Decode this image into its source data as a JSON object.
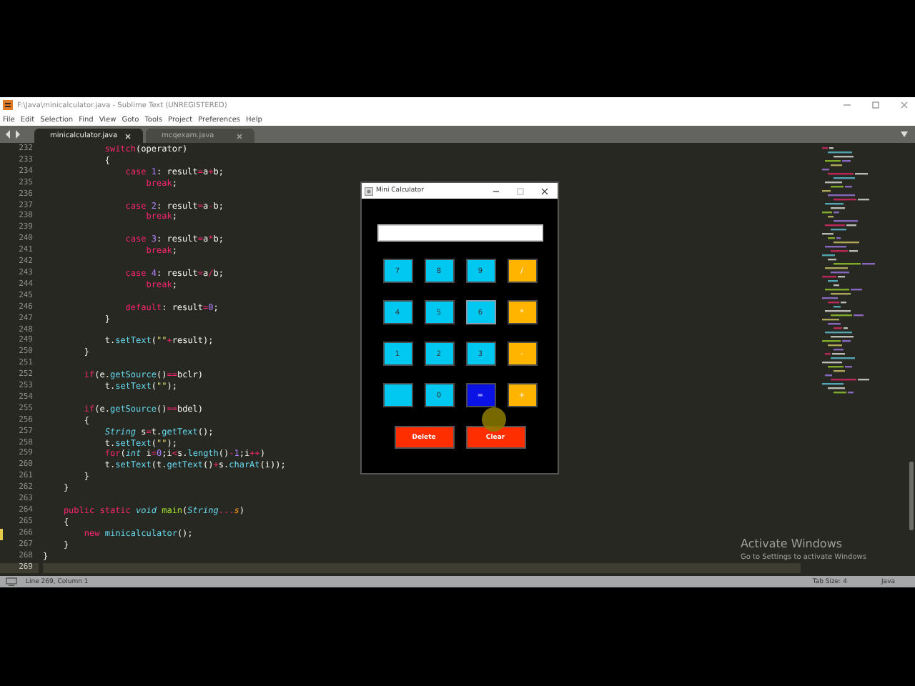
{
  "window": {
    "title": "F:\\Java\\minicalculator.java - Sublime Text (UNREGISTERED)"
  },
  "menu": [
    "File",
    "Edit",
    "Selection",
    "Find",
    "View",
    "Goto",
    "Tools",
    "Project",
    "Preferences",
    "Help"
  ],
  "tabs": [
    {
      "label": "minicalculator.java",
      "selected": true
    },
    {
      "label": "mcqexam.java",
      "selected": false
    }
  ],
  "editor": {
    "lines": [
      {
        "number": "232",
        "current": false,
        "modified": false,
        "tokens": [
          {
            "text": "            switch",
            "kind": "keyword"
          },
          {
            "text": "(operator)",
            "kind": "plain"
          }
        ]
      },
      {
        "number": "233",
        "current": false,
        "modified": false,
        "tokens": [
          {
            "text": "            {",
            "kind": "plain"
          }
        ]
      },
      {
        "number": "234",
        "current": false,
        "modified": false,
        "tokens": [
          {
            "text": "                case",
            "kind": "keyword"
          },
          {
            "text": " 1",
            "kind": "number"
          },
          {
            "text": ": result",
            "kind": "plain"
          },
          {
            "text": "=",
            "kind": "keyword"
          },
          {
            "text": "a",
            "kind": "plain"
          },
          {
            "text": "+",
            "kind": "keyword"
          },
          {
            "text": "b;",
            "kind": "plain"
          }
        ]
      },
      {
        "number": "235",
        "current": false,
        "modified": false,
        "tokens": [
          {
            "text": "                    break",
            "kind": "keyword"
          },
          {
            "text": ";",
            "kind": "plain"
          }
        ]
      },
      {
        "number": "236",
        "current": false,
        "modified": false
      },
      {
        "number": "237",
        "current": false,
        "modified": false,
        "tokens": [
          {
            "text": "                case",
            "kind": "keyword"
          },
          {
            "text": " 2",
            "kind": "number"
          },
          {
            "text": ": result",
            "kind": "plain"
          },
          {
            "text": "=",
            "kind": "keyword"
          },
          {
            "text": "a",
            "kind": "plain"
          },
          {
            "text": "-",
            "kind": "keyword"
          },
          {
            "text": "b;",
            "kind": "plain"
          }
        ]
      },
      {
        "number": "238",
        "current": false,
        "modified": false,
        "tokens": [
          {
            "text": "                    break",
            "kind": "keyword"
          },
          {
            "text": ";",
            "kind": "plain"
          }
        ]
      },
      {
        "number": "239",
        "current": false,
        "modified": false
      },
      {
        "number": "240",
        "current": false,
        "modified": false,
        "tokens": [
          {
            "text": "                case",
            "kind": "keyword"
          },
          {
            "text": " 3",
            "kind": "number"
          },
          {
            "text": ": result",
            "kind": "plain"
          },
          {
            "text": "=",
            "kind": "keyword"
          },
          {
            "text": "a",
            "kind": "plain"
          },
          {
            "text": "*",
            "kind": "keyword"
          },
          {
            "text": "b;",
            "kind": "plain"
          }
        ]
      },
      {
        "number": "241",
        "current": false,
        "modified": false,
        "tokens": [
          {
            "text": "                    break",
            "kind": "keyword"
          },
          {
            "text": ";",
            "kind": "plain"
          }
        ]
      },
      {
        "number": "242",
        "current": false,
        "modified": false
      },
      {
        "number": "243",
        "current": false,
        "modified": false,
        "tokens": [
          {
            "text": "                case",
            "kind": "keyword"
          },
          {
            "text": " 4",
            "kind": "number"
          },
          {
            "text": ": result",
            "kind": "plain"
          },
          {
            "text": "=",
            "kind": "keyword"
          },
          {
            "text": "a",
            "kind": "plain"
          },
          {
            "text": "/",
            "kind": "keyword"
          },
          {
            "text": "b;",
            "kind": "plain"
          }
        ]
      },
      {
        "number": "244",
        "current": false,
        "modified": false,
        "tokens": [
          {
            "text": "                    break",
            "kind": "keyword"
          },
          {
            "text": ";",
            "kind": "plain"
          }
        ]
      },
      {
        "number": "245",
        "current": false,
        "modified": false
      },
      {
        "number": "246",
        "current": false,
        "modified": false,
        "tokens": [
          {
            "text": "                default",
            "kind": "keyword"
          },
          {
            "text": ": result",
            "kind": "plain"
          },
          {
            "text": "=",
            "kind": "keyword"
          },
          {
            "text": "0",
            "kind": "number"
          },
          {
            "text": ";",
            "kind": "plain"
          }
        ]
      },
      {
        "number": "247",
        "current": false,
        "modified": false,
        "tokens": [
          {
            "text": "            }",
            "kind": "plain"
          }
        ]
      },
      {
        "number": "248",
        "current": false,
        "modified": false
      },
      {
        "number": "249",
        "current": false,
        "modified": false,
        "tokens": [
          {
            "text": "            t.",
            "kind": "plain"
          },
          {
            "text": "setText",
            "kind": "function"
          },
          {
            "text": "(",
            "kind": "plain"
          },
          {
            "text": "\"\"",
            "kind": "string"
          },
          {
            "text": "+",
            "kind": "keyword"
          },
          {
            "text": "result);",
            "kind": "plain"
          }
        ]
      },
      {
        "number": "250",
        "current": false,
        "modified": false,
        "tokens": [
          {
            "text": "        }",
            "kind": "plain"
          }
        ]
      },
      {
        "number": "251",
        "current": false,
        "modified": false
      },
      {
        "number": "252",
        "current": false,
        "modified": false,
        "tokens": [
          {
            "text": "        if",
            "kind": "keyword"
          },
          {
            "text": "(e.",
            "kind": "plain"
          },
          {
            "text": "getSource",
            "kind": "function"
          },
          {
            "text": "()",
            "kind": "plain"
          },
          {
            "text": "==",
            "kind": "keyword"
          },
          {
            "text": "bclr)",
            "kind": "plain"
          }
        ]
      },
      {
        "number": "253",
        "current": false,
        "modified": false,
        "tokens": [
          {
            "text": "            t.",
            "kind": "plain"
          },
          {
            "text": "setText",
            "kind": "function"
          },
          {
            "text": "(",
            "kind": "plain"
          },
          {
            "text": "\"\"",
            "kind": "string"
          },
          {
            "text": ");",
            "kind": "plain"
          }
        ]
      },
      {
        "number": "254",
        "current": false,
        "modified": false
      },
      {
        "number": "255",
        "current": false,
        "modified": false,
        "tokens": [
          {
            "text": "        if",
            "kind": "keyword"
          },
          {
            "text": "(e.",
            "kind": "plain"
          },
          {
            "text": "getSource",
            "kind": "function"
          },
          {
            "text": "()",
            "kind": "plain"
          },
          {
            "text": "==",
            "kind": "keyword"
          },
          {
            "text": "bdel)",
            "kind": "plain"
          }
        ]
      },
      {
        "number": "256",
        "current": false,
        "modified": false,
        "tokens": [
          {
            "text": "        {",
            "kind": "plain"
          }
        ]
      },
      {
        "number": "257",
        "current": false,
        "modified": false,
        "tokens": [
          {
            "text": "            String",
            "kind": "type"
          },
          {
            "text": " s",
            "kind": "plain"
          },
          {
            "text": "=",
            "kind": "keyword"
          },
          {
            "text": "t.",
            "kind": "plain"
          },
          {
            "text": "getText",
            "kind": "function"
          },
          {
            "text": "();",
            "kind": "plain"
          }
        ]
      },
      {
        "number": "258",
        "current": false,
        "modified": false,
        "tokens": [
          {
            "text": "            t.",
            "kind": "plain"
          },
          {
            "text": "setText",
            "kind": "function"
          },
          {
            "text": "(",
            "kind": "plain"
          },
          {
            "text": "\"\"",
            "kind": "string"
          },
          {
            "text": ");",
            "kind": "plain"
          }
        ]
      },
      {
        "number": "259",
        "current": false,
        "modified": false,
        "tokens": [
          {
            "text": "            for",
            "kind": "keyword"
          },
          {
            "text": "(",
            "kind": "plain"
          },
          {
            "text": "int",
            "kind": "type"
          },
          {
            "text": " i",
            "kind": "plain"
          },
          {
            "text": "=",
            "kind": "keyword"
          },
          {
            "text": "0",
            "kind": "number"
          },
          {
            "text": ";i",
            "kind": "plain"
          },
          {
            "text": "<",
            "kind": "keyword"
          },
          {
            "text": "s.",
            "kind": "plain"
          },
          {
            "text": "length",
            "kind": "function"
          },
          {
            "text": "()",
            "kind": "plain"
          },
          {
            "text": "-",
            "kind": "keyword"
          },
          {
            "text": "1",
            "kind": "number"
          },
          {
            "text": ";i",
            "kind": "plain"
          },
          {
            "text": "++",
            "kind": "keyword"
          },
          {
            "text": ")",
            "kind": "plain"
          }
        ]
      },
      {
        "number": "260",
        "current": false,
        "modified": false,
        "tokens": [
          {
            "text": "            t.",
            "kind": "plain"
          },
          {
            "text": "setText",
            "kind": "function"
          },
          {
            "text": "(t.",
            "kind": "plain"
          },
          {
            "text": "getText",
            "kind": "function"
          },
          {
            "text": "()",
            "kind": "plain"
          },
          {
            "text": "+",
            "kind": "keyword"
          },
          {
            "text": "s.",
            "kind": "plain"
          },
          {
            "text": "charAt",
            "kind": "function"
          },
          {
            "text": "(i));",
            "kind": "plain"
          }
        ]
      },
      {
        "number": "261",
        "current": false,
        "modified": false,
        "tokens": [
          {
            "text": "        }",
            "kind": "plain"
          }
        ]
      },
      {
        "number": "262",
        "current": false,
        "modified": false,
        "tokens": [
          {
            "text": "    }",
            "kind": "plain"
          }
        ]
      },
      {
        "number": "263",
        "current": false,
        "modified": false
      },
      {
        "number": "264",
        "current": false,
        "modified": false,
        "tokens": [
          {
            "text": "    public static",
            "kind": "keyword"
          },
          {
            "text": " void",
            "kind": "type"
          },
          {
            "text": " main",
            "kind": "name"
          },
          {
            "text": "(",
            "kind": "plain"
          },
          {
            "text": "String",
            "kind": "type"
          },
          {
            "text": "...",
            "kind": "keyword"
          },
          {
            "text": "s",
            "kind": "parameter"
          },
          {
            "text": ")",
            "kind": "plain"
          }
        ]
      },
      {
        "number": "265",
        "current": false,
        "modified": false,
        "tokens": [
          {
            "text": "    {",
            "kind": "plain"
          }
        ]
      },
      {
        "number": "266",
        "current": false,
        "modified": true,
        "tokens": [
          {
            "text": "        new",
            "kind": "keyword"
          },
          {
            "text": " minicalculator",
            "kind": "function"
          },
          {
            "text": "();",
            "kind": "plain"
          }
        ]
      },
      {
        "number": "267",
        "current": false,
        "modified": false,
        "tokens": [
          {
            "text": "    }",
            "kind": "plain"
          }
        ]
      },
      {
        "number": "268",
        "current": false,
        "modified": false,
        "tokens": [
          {
            "text": "}",
            "kind": "plain"
          }
        ]
      },
      {
        "number": "269",
        "current": true,
        "modified": false
      }
    ]
  },
  "status_bar": {
    "position": "Line 269, Column 1",
    "tab_size": "Tab Size: 4",
    "syntax": "Java"
  },
  "activation_notice": {
    "title": "Activate Windows",
    "message": "Go to Settings to activate Windows"
  },
  "calculator": {
    "title": "Mini Calculator",
    "keys": [
      {
        "label": "7",
        "kind": "digit",
        "focused": false
      },
      {
        "label": "8",
        "kind": "digit",
        "focused": false
      },
      {
        "label": "9",
        "kind": "digit",
        "focused": false
      },
      {
        "label": "/",
        "kind": "operator",
        "focused": false
      },
      {
        "label": "4",
        "kind": "digit",
        "focused": false
      },
      {
        "label": "5",
        "kind": "digit",
        "focused": false
      },
      {
        "label": "6",
        "kind": "digit",
        "focused": true
      },
      {
        "label": "*",
        "kind": "operator",
        "focused": false
      },
      {
        "label": "1",
        "kind": "digit",
        "focused": false
      },
      {
        "label": "2",
        "kind": "digit",
        "focused": false
      },
      {
        "label": "3",
        "kind": "digit",
        "focused": false
      },
      {
        "label": "-",
        "kind": "operator",
        "focused": false
      },
      {
        "kind": "digit",
        "focused": false
      },
      {
        "label": "0",
        "kind": "digit",
        "focused": false
      },
      {
        "label": "=",
        "kind": "equals",
        "focused": false
      },
      {
        "label": "+",
        "kind": "operator",
        "focused": false
      }
    ],
    "actions": [
      "Delete",
      "Clear"
    ]
  }
}
